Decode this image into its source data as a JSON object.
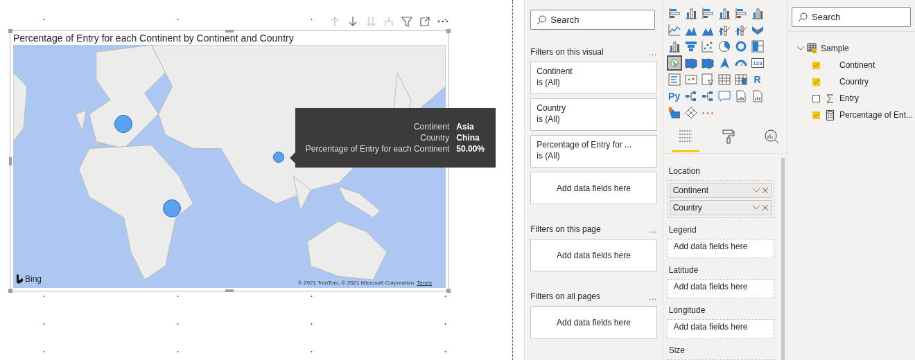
{
  "visual": {
    "title": "Percentage of Entry for each Continent by Continent and Country",
    "map": {
      "attribution": "Bing",
      "copyright": "© 2021 TomTom, © 2021 Microsoft Corporation",
      "terms": "Terms",
      "bubbles": [
        {
          "kind": "large"
        },
        {
          "kind": "small"
        },
        {
          "kind": "large"
        }
      ]
    },
    "tooltip": {
      "rows": [
        {
          "label": "Continent",
          "value": "Asia"
        },
        {
          "label": "Country",
          "value": "China"
        },
        {
          "label": "Percentage of Entry for each Continent",
          "value": "50.00%"
        }
      ]
    }
  },
  "filters": {
    "search": {
      "placeholder": "Search"
    },
    "sections": [
      {
        "title": "Filters on this visual",
        "more": "…",
        "cards": [
          {
            "name": "Continent",
            "condition": "is (All)"
          },
          {
            "name": "Country",
            "condition": "is (All)"
          },
          {
            "name": "Percentage of Entry for ...",
            "condition": "is (All)"
          }
        ],
        "drop": "Add data fields here"
      },
      {
        "title": "Filters on this page",
        "more": "…",
        "drop": "Add data fields here"
      },
      {
        "title": "Filters on all pages",
        "more": "…",
        "drop": "Add data fields here"
      }
    ]
  },
  "visualizations": {
    "types": [
      {
        "kind": "hbar",
        "selected": false
      },
      {
        "kind": "column",
        "selected": false
      },
      {
        "kind": "hbar",
        "selected": false
      },
      {
        "kind": "column",
        "selected": false
      },
      {
        "kind": "hbar",
        "selected": false
      },
      {
        "kind": "column",
        "selected": false
      },
      {
        "kind": "line",
        "selected": false
      },
      {
        "kind": "area",
        "selected": false
      },
      {
        "kind": "area",
        "selected": false
      },
      {
        "kind": "combo",
        "selected": false
      },
      {
        "kind": "combo",
        "selected": false
      },
      {
        "kind": "ribbon",
        "selected": false
      },
      {
        "kind": "column",
        "selected": false
      },
      {
        "kind": "funnel",
        "selected": false
      },
      {
        "kind": "scatter",
        "selected": false
      },
      {
        "kind": "pie",
        "selected": false
      },
      {
        "kind": "donut",
        "selected": false
      },
      {
        "kind": "treemap",
        "selected": false
      },
      {
        "kind": "globe",
        "selected": true
      },
      {
        "kind": "filledmap",
        "selected": false
      },
      {
        "kind": "filledmap",
        "selected": false
      },
      {
        "kind": "arrow",
        "selected": false
      },
      {
        "kind": "gauge",
        "selected": false
      },
      {
        "kind": "card",
        "label": "123",
        "selected": false
      },
      {
        "kind": "list",
        "selected": false
      },
      {
        "kind": "kpi",
        "selected": false
      },
      {
        "kind": "slicer",
        "selected": false
      },
      {
        "kind": "table",
        "selected": false
      },
      {
        "kind": "matrix",
        "selected": false
      },
      {
        "kind": "text",
        "label": "R",
        "selected": false
      },
      {
        "kind": "text",
        "label": "Py",
        "selected": false
      },
      {
        "kind": "tree",
        "selected": false
      },
      {
        "kind": "tree",
        "selected": false
      },
      {
        "kind": "speech",
        "selected": false
      },
      {
        "kind": "doc",
        "selected": false
      },
      {
        "kind": "doc",
        "selected": false
      },
      {
        "kind": "shape",
        "selected": false
      },
      {
        "kind": "diamond",
        "selected": false
      },
      {
        "kind": "more",
        "selected": false
      }
    ],
    "tabs": [
      {
        "kind": "fields",
        "selected": true
      },
      {
        "kind": "format",
        "selected": false
      },
      {
        "kind": "analytics",
        "selected": false
      }
    ],
    "wells": [
      {
        "label": "Location",
        "fields": [
          "Continent",
          "Country"
        ]
      },
      {
        "label": "Legend",
        "placeholder": "Add data fields here"
      },
      {
        "label": "Latitude",
        "placeholder": "Add data fields here"
      },
      {
        "label": "Longitude",
        "placeholder": "Add data fields here"
      },
      {
        "label": "Size"
      }
    ]
  },
  "fields": {
    "search": {
      "placeholder": "Search"
    },
    "tables": [
      {
        "name": "Sample",
        "expanded": true,
        "children": [
          {
            "name": "Continent",
            "checked": true,
            "kind": "text"
          },
          {
            "name": "Country",
            "checked": true,
            "kind": "text"
          },
          {
            "name": "Entry",
            "checked": false,
            "kind": "sum"
          },
          {
            "name": "Percentage of Ent...",
            "checked": true,
            "kind": "measure"
          }
        ]
      }
    ]
  }
}
